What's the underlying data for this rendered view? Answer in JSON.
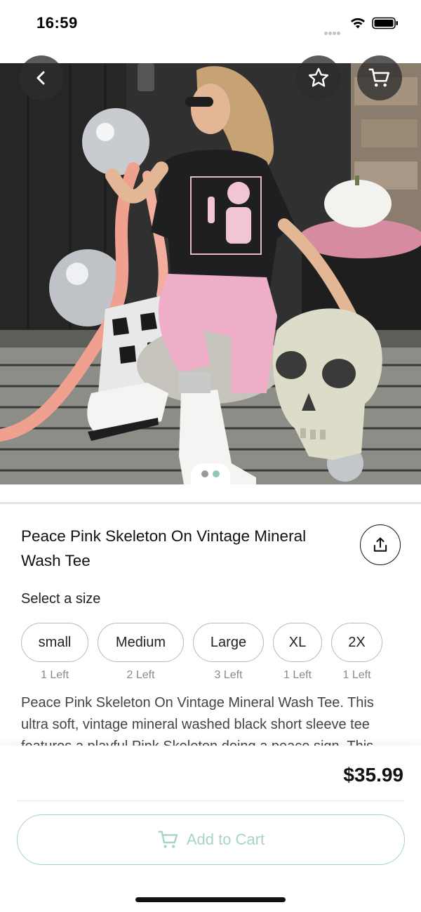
{
  "status_bar": {
    "time": "16:59"
  },
  "product": {
    "title": "Peace Pink Skeleton On Vintage Mineral Wash Tee",
    "size_prompt": "Select a size",
    "sizes": [
      {
        "label": "small",
        "stock": "1 Left"
      },
      {
        "label": "Medium",
        "stock": "2 Left"
      },
      {
        "label": "Large",
        "stock": "3 Left"
      },
      {
        "label": "XL",
        "stock": "1 Left"
      },
      {
        "label": "2X",
        "stock": "1 Left"
      }
    ],
    "description": "Peace Pink Skeleton On Vintage Mineral Wash Tee. This ultra soft, vintage mineral washed black short sleeve tee features a playful Pink Skeleton doing a peace sign. This",
    "price": "$35.99"
  },
  "gallery": {
    "image_count": 2,
    "current_index": 1
  },
  "actions": {
    "add_to_cart": "Add to Cart"
  },
  "icons": {
    "back": "chevron-left-icon",
    "favorite": "star-icon",
    "cart": "cart-icon",
    "share": "share-icon"
  },
  "colors": {
    "accent": "#a7d5c4",
    "pager_inactive": "#9a9a9a",
    "pager_active": "#8fc8b4",
    "button_overlay": "#2d2d2d"
  }
}
